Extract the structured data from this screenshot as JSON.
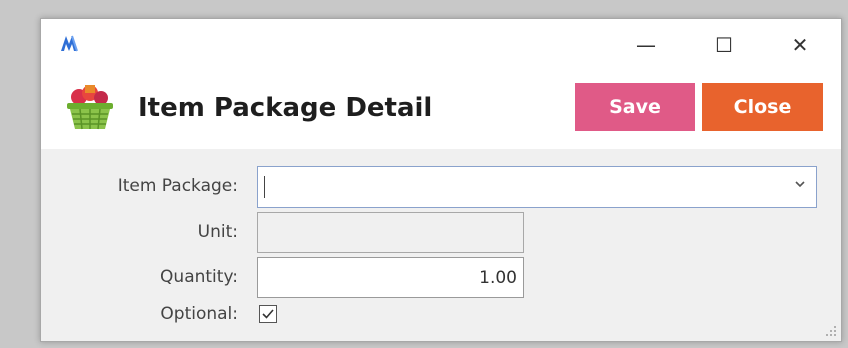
{
  "window": {
    "minimize_glyph": "—",
    "maximize_glyph": "☐",
    "close_glyph": "✕"
  },
  "header": {
    "title": "Item Package Detail",
    "save_label": "Save",
    "close_label": "Close"
  },
  "form": {
    "item_package": {
      "label": "Item Package:",
      "value": ""
    },
    "unit": {
      "label": "Unit:",
      "value": ""
    },
    "quantity": {
      "label": "Quantity:",
      "value": "1.00"
    },
    "optional": {
      "label": "Optional:",
      "checked": true
    }
  },
  "colors": {
    "save": "#e05a87",
    "close": "#e8632d",
    "app_icon": "#2f6fd6"
  },
  "icons": {
    "app": "app-logo-icon",
    "header": "basket-icon",
    "dropdown": "chevron-down-icon",
    "checkbox": "checkmark-icon",
    "grip": "resize-grip-icon"
  }
}
